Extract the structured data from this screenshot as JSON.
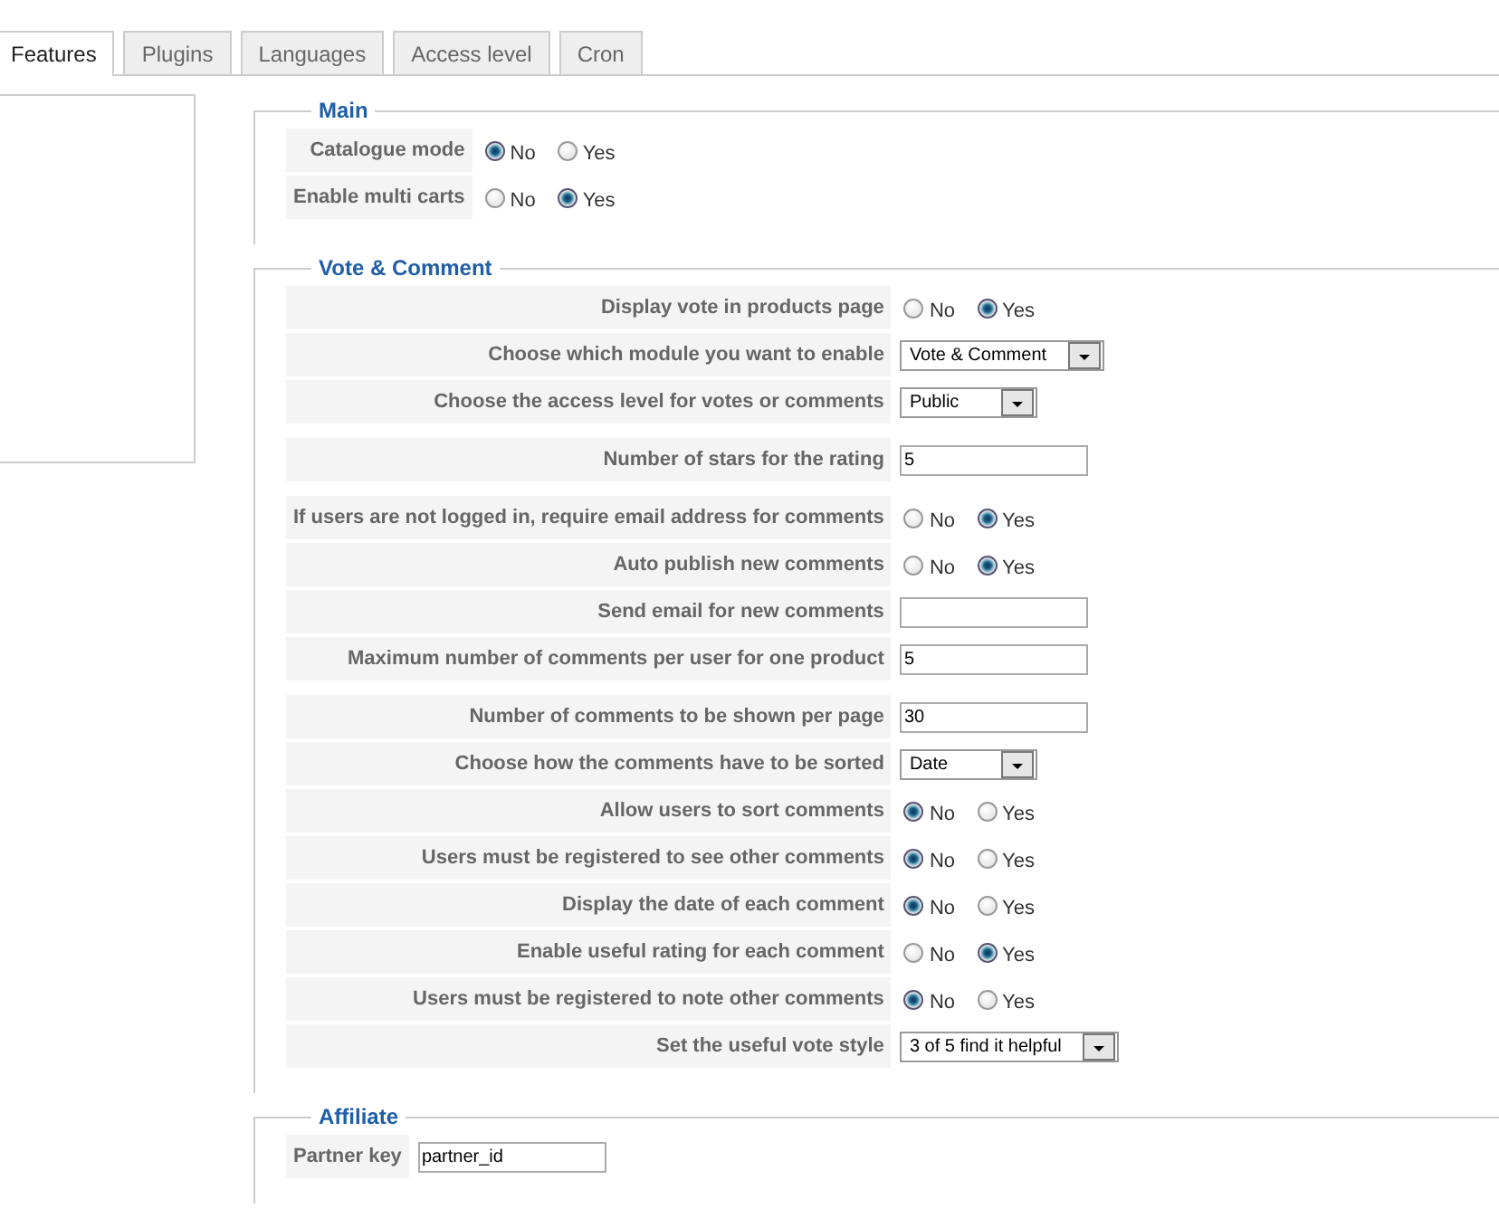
{
  "tabs": [
    {
      "label": "Features",
      "selected": true
    },
    {
      "label": "Plugins",
      "selected": false
    },
    {
      "label": "Languages",
      "selected": false
    },
    {
      "label": "Access level",
      "selected": false
    },
    {
      "label": "Cron",
      "selected": false
    }
  ],
  "sections": [
    {
      "title": "Main",
      "groups": [
        [
          {
            "label": "Catalogue mode",
            "kind": "radio",
            "options": [
              {
                "label": "No",
                "selected": true
              },
              {
                "label": "Yes",
                "selected": false
              }
            ]
          },
          {
            "label": "Enable multi carts",
            "kind": "radio",
            "options": [
              {
                "label": "No",
                "selected": false
              },
              {
                "label": "Yes",
                "selected": true
              }
            ]
          }
        ]
      ]
    },
    {
      "title": "Vote & Comment",
      "groups": [
        [
          {
            "label": "Display vote in products page",
            "kind": "radio",
            "options": [
              {
                "label": "No",
                "selected": false
              },
              {
                "label": "Yes",
                "selected": true
              }
            ]
          },
          {
            "label": "Choose which module you want to enable",
            "kind": "select",
            "value": "Vote & Comment"
          },
          {
            "label": "Choose the access level for votes or comments",
            "kind": "select",
            "value": "Public"
          }
        ],
        [
          {
            "label": "Number of stars for the rating",
            "kind": "text",
            "value": "5"
          }
        ],
        [
          {
            "label": "If users are not logged in, require email address for comments",
            "kind": "radio",
            "options": [
              {
                "label": "No",
                "selected": false
              },
              {
                "label": "Yes",
                "selected": true
              }
            ]
          },
          {
            "label": "Auto publish new comments",
            "kind": "radio",
            "options": [
              {
                "label": "No",
                "selected": false
              },
              {
                "label": "Yes",
                "selected": true
              }
            ]
          },
          {
            "label": "Send email for new comments",
            "kind": "text"
          },
          {
            "label": "Maximum number of comments per user for one product",
            "kind": "text",
            "value": "5"
          }
        ],
        [
          {
            "label": "Number of comments to be shown per page",
            "kind": "text",
            "value": "30"
          },
          {
            "label": "Choose how the comments have to be sorted",
            "kind": "select",
            "value": "Date"
          },
          {
            "label": "Allow users to sort comments",
            "kind": "radio",
            "options": [
              {
                "label": "No",
                "selected": true
              },
              {
                "label": "Yes",
                "selected": false
              }
            ]
          },
          {
            "label": "Users must be registered to see other comments",
            "kind": "radio",
            "options": [
              {
                "label": "No",
                "selected": true
              },
              {
                "label": "Yes",
                "selected": false
              }
            ]
          },
          {
            "label": "Display the date of each comment",
            "kind": "radio",
            "options": [
              {
                "label": "No",
                "selected": true
              },
              {
                "label": "Yes",
                "selected": false
              }
            ]
          },
          {
            "label": "Enable useful rating for each comment",
            "kind": "radio",
            "options": [
              {
                "label": "No",
                "selected": false
              },
              {
                "label": "Yes",
                "selected": true
              }
            ]
          },
          {
            "label": "Users must be registered to note other comments",
            "kind": "radio",
            "options": [
              {
                "label": "No",
                "selected": true
              },
              {
                "label": "Yes",
                "selected": false
              }
            ]
          },
          {
            "label": "Set the useful vote style",
            "kind": "select",
            "value": "3 of 5 find it helpful"
          }
        ]
      ]
    },
    {
      "title": "Affiliate",
      "groups": [
        [
          {
            "label": "Partner key",
            "kind": "text",
            "value": "partner_id"
          }
        ]
      ]
    }
  ]
}
